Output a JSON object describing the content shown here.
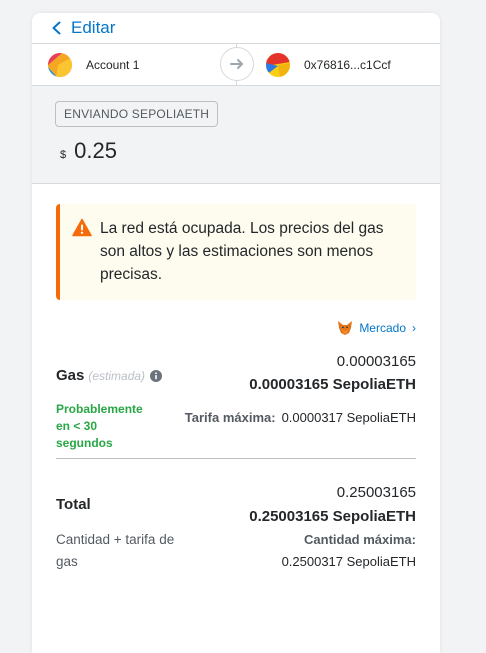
{
  "header": {
    "back_label": "Editar"
  },
  "from": {
    "name": "Account 1"
  },
  "to": {
    "address": "0x76816...c1Ccf"
  },
  "amount": {
    "tag": "ENVIANDO SEPOLIAETH",
    "symbol": "$",
    "value": "0.25"
  },
  "warning": {
    "text": "La red está ocupada. Los precios del gas son altos y las estimaciones son menos precisas."
  },
  "market": {
    "label": "Mercado"
  },
  "gas": {
    "label": "Gas",
    "estimated": "(estimada)",
    "fiat": "0.00003165",
    "native": "0.00003165 SepoliaETH",
    "likely": "Probablemente en < 30 segundos",
    "max_fee_key": "Tarifa máxima:",
    "max_fee_value": "0.0000317 SepoliaETH"
  },
  "total": {
    "label": "Total",
    "fiat": "0.25003165",
    "native": "0.25003165 SepoliaETH",
    "sub": "Cantidad + tarifa de gas",
    "max_amount_key": "Cantidad máxima:",
    "max_amount_value": "0.2500317 SepoliaETH"
  },
  "colors": {
    "link": "#0376c9",
    "warning_accent": "#f66a0a",
    "success": "#28a745"
  }
}
